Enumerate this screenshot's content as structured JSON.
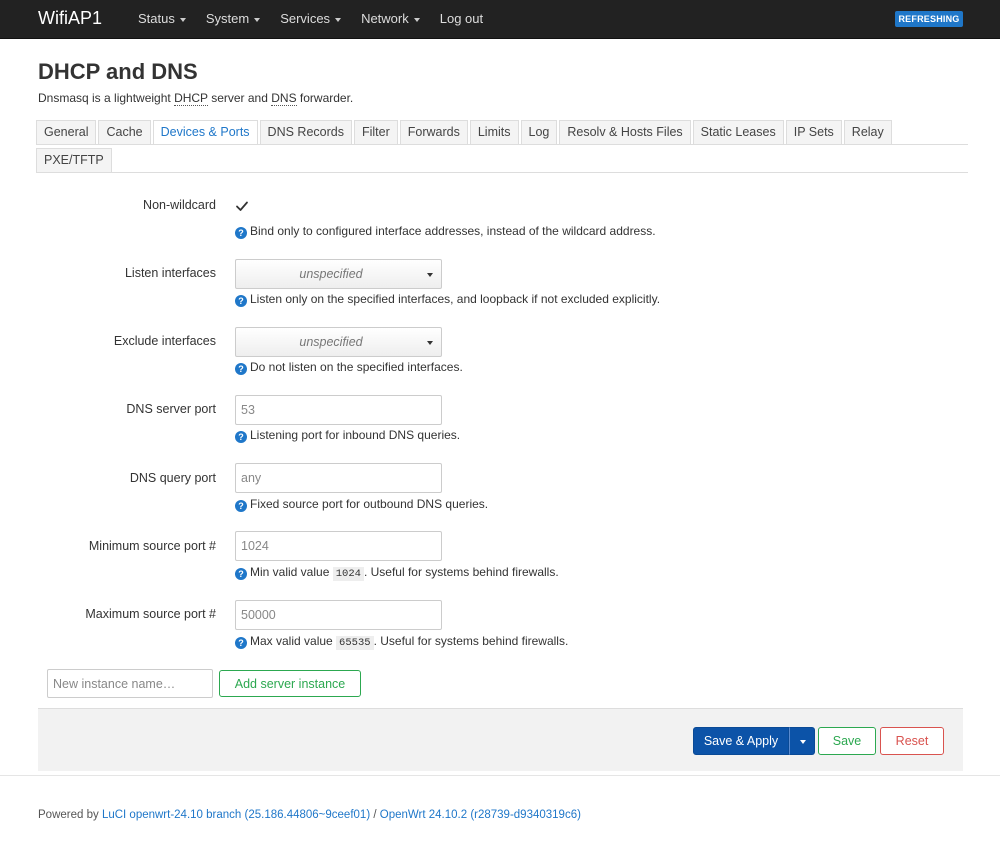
{
  "navbar": {
    "brand": "WifiAP1",
    "menu": [
      "Status",
      "System",
      "Services",
      "Network"
    ],
    "logout": "Log out",
    "badge": "REFRESHING"
  },
  "page": {
    "title": "DHCP and DNS",
    "desc_prefix": "Dnsmasq is a lightweight ",
    "desc_abbr1": "DHCP",
    "desc_mid": " server and ",
    "desc_abbr2": "DNS",
    "desc_suffix": " forwarder."
  },
  "tabs": {
    "row1": [
      "General",
      "Cache",
      "Devices & Ports",
      "DNS Records",
      "Filter",
      "Forwards",
      "Limits",
      "Log",
      "Resolv & Hosts Files",
      "Static Leases",
      "IP Sets",
      "Relay"
    ],
    "row2": [
      "PXE/TFTP"
    ],
    "active": "Devices & Ports"
  },
  "fields": {
    "nonwildcard": {
      "label": "Non-wildcard",
      "checked": true,
      "help": "Bind only to configured interface addresses, instead of the wildcard address."
    },
    "listen": {
      "label": "Listen interfaces",
      "value": "unspecified",
      "help": "Listen only on the specified interfaces, and loopback if not excluded explicitly."
    },
    "exclude": {
      "label": "Exclude interfaces",
      "value": "unspecified",
      "help": "Do not listen on the specified interfaces."
    },
    "dnsport": {
      "label": "DNS server port",
      "placeholder": "53",
      "help": "Listening port for inbound DNS queries."
    },
    "queryport": {
      "label": "DNS query port",
      "placeholder": "any",
      "help": "Fixed source port for outbound DNS queries."
    },
    "minport": {
      "label": "Minimum source port #",
      "placeholder": "1024",
      "help_prefix": "Min valid value ",
      "help_code": "1024",
      "help_suffix": ". Useful for systems behind firewalls."
    },
    "maxport": {
      "label": "Maximum source port #",
      "placeholder": "50000",
      "help_prefix": "Max valid value ",
      "help_code": "65535",
      "help_suffix": ". Useful for systems behind firewalls."
    }
  },
  "instance": {
    "placeholder": "New instance name…",
    "add_label": "Add server instance"
  },
  "actions": {
    "apply": "Save & Apply",
    "save": "Save",
    "reset": "Reset"
  },
  "footer": {
    "prefix": "Powered by ",
    "luci_link": "LuCI openwrt-24.10 branch (25.186.44806~9ceef01)",
    "sep": " / ",
    "openwrt_link": "OpenWrt 24.10.2 (r28739-d9340319c6)"
  },
  "colors": {
    "accent": "#1f77c9",
    "primary": "#0c53a8",
    "success": "#2ca850",
    "danger": "#d9534f",
    "navbar": "#222222"
  },
  "icons": {
    "help": "question-circle-icon",
    "check": "checkmark-icon",
    "caret": "caret-down-icon"
  }
}
